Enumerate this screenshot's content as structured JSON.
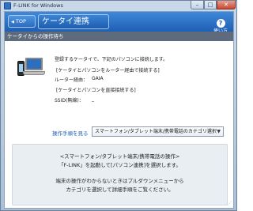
{
  "window": {
    "title": "F-LINK for Windows",
    "controls": {
      "minimize": "–",
      "maximize": "□",
      "close": "✕"
    }
  },
  "header": {
    "top_button": "TOP",
    "title": "ケータイ連携",
    "help_label": "使い方",
    "help_icon": "?"
  },
  "status": "ケータイからの操作待ち",
  "info": {
    "intro": "登録するケータイで、下記のパソコンに接続します。",
    "via_router_heading": "[ケータイとパソコンをルーター経由で接続する]",
    "router_label": "ルーター経由：",
    "router_value": "GAIA",
    "direct_heading": "[ケータイとパソコンを直接接続する]",
    "ssid_label": "SSID(無線)：",
    "ssid_value": "_"
  },
  "procedure": {
    "label": "操作手順を見る",
    "selected": "スマートフォン/タブレット端末/携帯電話のカテゴリ選択"
  },
  "note": {
    "line1": "<スマートフォン/タブレット端末/携帯電話の操作>",
    "line2": "「F-LINK」を起動して[パソコン連携]を選択します。",
    "line3": "端末の操作がわからないときはプルダウンメニューから",
    "line4": "カテゴリを選択して詳細手順をご覧ください。"
  },
  "colors": {
    "header_blue": "#1f5fb4",
    "status_gray": "#5d6b7c",
    "link_blue": "#1f5fb4",
    "close_red": "#c54a33"
  },
  "icons": [
    "app-icon",
    "back-arrow-icon",
    "help-icon",
    "phone-laptop-illustration",
    "dropdown-arrow-icon",
    "resize-grip-icon"
  ]
}
